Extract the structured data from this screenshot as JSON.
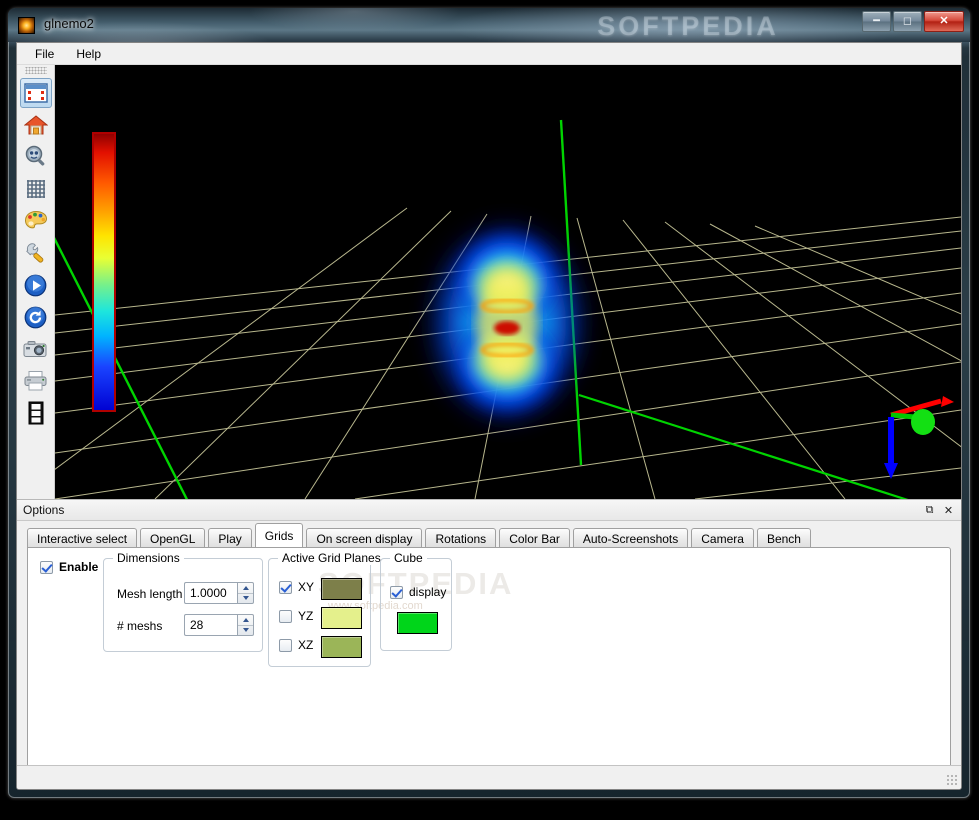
{
  "window": {
    "title": "glnemo2",
    "app_icon": "glnemo-sun-icon",
    "watermark": "SOFTPEDIA",
    "buttons": {
      "minimize": "–",
      "maximize": "▫",
      "close": "✕"
    }
  },
  "menubar": {
    "items": [
      {
        "label": "File",
        "name": "menu-file"
      },
      {
        "label": "Help",
        "name": "menu-help"
      }
    ]
  },
  "toolbar": {
    "items": [
      {
        "name": "select-region-icon",
        "tip": "Interactive select"
      },
      {
        "name": "home-icon",
        "tip": "Reset view"
      },
      {
        "name": "zoom-icon",
        "tip": "Zoom"
      },
      {
        "name": "grid-icon",
        "tip": "Grid"
      },
      {
        "name": "palette-icon",
        "tip": "Colors"
      },
      {
        "name": "wrench-icon",
        "tip": "Options"
      },
      {
        "name": "play-icon",
        "tip": "Play"
      },
      {
        "name": "reload-icon",
        "tip": "Reload"
      },
      {
        "name": "camera-icon",
        "tip": "Screenshot"
      },
      {
        "name": "printer-icon",
        "tip": "Print"
      },
      {
        "name": "movie-frames-icon",
        "tip": "Frames"
      }
    ]
  },
  "viewport": {
    "name": "gl-3d-viewport",
    "background": "#000000",
    "grid_color": "#c8c79a",
    "axis_color_x": "#ff0000",
    "axis_color_y": "#00d400",
    "axis_color_z": "#0000ff",
    "colorbar": {
      "name": "color-bar",
      "border": "#b00000",
      "stops": [
        "#8b0000",
        "#ff2a00",
        "#ff8c00",
        "#ffd000",
        "#f6ff3a",
        "#9bf06a",
        "#45f0c0",
        "#00e5ff",
        "#00a8ff",
        "#1640ff",
        "#0000c8"
      ]
    },
    "particles": {
      "name": "nbody-particle-cloud",
      "halo": "#0b4dff",
      "mid": "#19d2ff",
      "warm": "#f2e85a",
      "core": "#cc1100"
    }
  },
  "options_dock": {
    "title": "Options",
    "float_button": "⧉",
    "close_button": "✕",
    "tabs": [
      {
        "label": "Interactive select",
        "active": false
      },
      {
        "label": "OpenGL",
        "active": false
      },
      {
        "label": "Play",
        "active": false
      },
      {
        "label": "Grids",
        "active": true
      },
      {
        "label": "On screen display",
        "active": false
      },
      {
        "label": "Rotations",
        "active": false
      },
      {
        "label": "Color Bar",
        "active": false
      },
      {
        "label": "Auto-Screenshots",
        "active": false
      },
      {
        "label": "Camera",
        "active": false
      },
      {
        "label": "Bench",
        "active": false
      }
    ],
    "page_watermark": "SOFTPEDIA",
    "page_watermark_sub": "www.softpedia.com",
    "grids_page": {
      "enable": {
        "label": "Enable",
        "checked": true
      },
      "dimensions": {
        "title": "Dimensions",
        "mesh_length": {
          "label": "Mesh length",
          "value": "1.0000"
        },
        "num_meshs": {
          "label": "# meshs",
          "value": "28"
        }
      },
      "active_grid_planes": {
        "title": "Active Grid Planes",
        "rows": [
          {
            "label": "XY",
            "checked": true,
            "color": "#7d7f4a"
          },
          {
            "label": "YZ",
            "checked": false,
            "color": "#e4f08c"
          },
          {
            "label": "XZ",
            "checked": false,
            "color": "#9bb558"
          }
        ]
      },
      "cube": {
        "title": "Cube",
        "display": {
          "label": "display",
          "checked": true
        },
        "color": "#00d51a"
      }
    }
  },
  "statusbar": {
    "text": ""
  }
}
